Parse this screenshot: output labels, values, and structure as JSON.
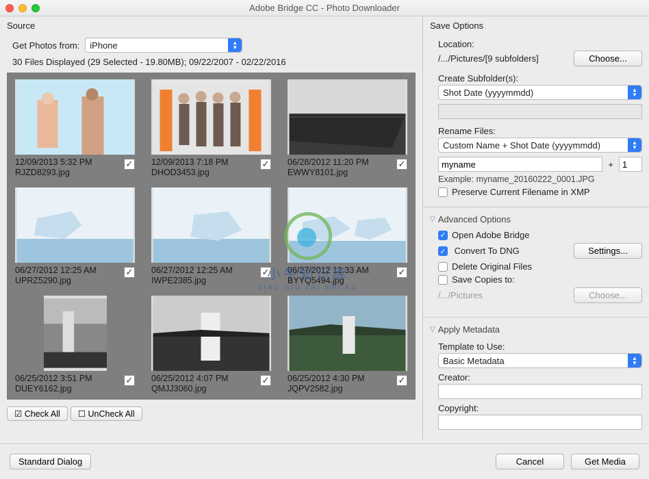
{
  "window": {
    "title": "Adobe Bridge CC - Photo Downloader"
  },
  "source": {
    "header": "Source",
    "get_photos_label": "Get Photos from:",
    "device": "iPhone",
    "status": "30 Files Displayed (29 Selected - 19.80MB); 09/22/2007 - 02/22/2016"
  },
  "thumbs": [
    {
      "date": "12/09/2013 5:32 PM",
      "file": "RJZD8293.jpg",
      "checked": true
    },
    {
      "date": "12/09/2013 7:18 PM",
      "file": "DHOD3453.jpg",
      "checked": true
    },
    {
      "date": "06/28/2012 11:20 PM",
      "file": "EWWY8101.jpg",
      "checked": true
    },
    {
      "date": "06/27/2012 12:25 AM",
      "file": "UPRZ5290.jpg",
      "checked": true
    },
    {
      "date": "06/27/2012 12:25 AM",
      "file": "IWPE2385.jpg",
      "checked": true
    },
    {
      "date": "06/27/2012 12:33 AM",
      "file": "BYYQ5494.jpg",
      "checked": true
    },
    {
      "date": "06/25/2012 3:51 PM",
      "file": "DUEY6162.jpg",
      "checked": true
    },
    {
      "date": "06/25/2012 4:07 PM",
      "file": "QMJJ3060.jpg",
      "checked": true
    },
    {
      "date": "06/25/2012 4:30 PM",
      "file": "JQPV2582.jpg",
      "checked": true
    }
  ],
  "check_buttons": {
    "check_all": "Check All",
    "uncheck_all": "UnCheck All"
  },
  "save": {
    "header": "Save Options",
    "location_label": "Location:",
    "location_path": "/.../Pictures/[9 subfolders]",
    "choose": "Choose...",
    "create_sub_label": "Create Subfolder(s):",
    "create_sub_value": "Shot Date (yyyymmdd)",
    "rename_label": "Rename Files:",
    "rename_value": "Custom Name + Shot Date (yyyymmdd)",
    "custom_name": "myname",
    "plus": "+",
    "seq": "1",
    "example": "Example: myname_20160222_0001.JPG",
    "preserve": "Preserve Current Filename in XMP"
  },
  "advanced": {
    "header": "Advanced Options",
    "open_bridge": "Open Adobe Bridge",
    "convert_dng": "Convert To DNG",
    "settings": "Settings...",
    "delete_orig": "Delete Original Files",
    "save_copies": "Save Copies to:",
    "copies_path": "/.../Pictures",
    "choose": "Choose..."
  },
  "metadata": {
    "header": "Apply Metadata",
    "template_label": "Template to Use:",
    "template_value": "Basic Metadata",
    "creator_label": "Creator:",
    "copyright_label": "Copyright:"
  },
  "footer": {
    "standard": "Standard Dialog",
    "cancel": "Cancel",
    "get_media": "Get Media"
  },
  "watermark": {
    "cn": "小牛知识库",
    "en": "XIAO NIU ZHI SHI KU"
  }
}
